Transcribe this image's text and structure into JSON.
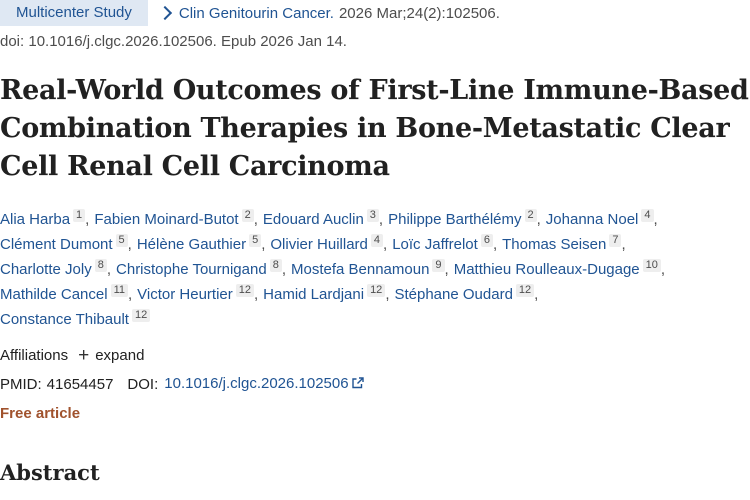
{
  "header": {
    "publication_type": "Multicenter Study",
    "journal_link": "Clin Genitourin Cancer.",
    "citation": "2026 Mar;24(2):102506.",
    "doi_line": "doi: 10.1016/j.clgc.2026.102506. Epub 2026 Jan 14."
  },
  "article": {
    "title": "Real-World Outcomes of First-Line Immune-Based Combination Therapies in Bone-Metastatic Clear Cell Renal Cell Carcinoma"
  },
  "authors": [
    [
      {
        "name": "Alia Harba",
        "aff": "1"
      },
      {
        "name": "Fabien Moinard-Butot",
        "aff": "2"
      },
      {
        "name": "Edouard Auclin",
        "aff": "3"
      },
      {
        "name": "Philippe Barthélémy",
        "aff": "2"
      },
      {
        "name": "Johanna Noel",
        "aff": "4"
      }
    ],
    [
      {
        "name": "Clément Dumont",
        "aff": "5"
      },
      {
        "name": "Hélène Gauthier",
        "aff": "5"
      },
      {
        "name": "Olivier Huillard",
        "aff": "4"
      },
      {
        "name": "Loïc Jaffrelot",
        "aff": "6"
      },
      {
        "name": "Thomas Seisen",
        "aff": "7"
      }
    ],
    [
      {
        "name": "Charlotte Joly",
        "aff": "8"
      },
      {
        "name": "Christophe Tournigand",
        "aff": "8"
      },
      {
        "name": "Mostefa Bennamoun",
        "aff": "9"
      },
      {
        "name": "Matthieu Roulleaux-Dugage",
        "aff": "10"
      }
    ],
    [
      {
        "name": "Mathilde Cancel",
        "aff": "11"
      },
      {
        "name": "Victor Heurtier",
        "aff": "12"
      },
      {
        "name": "Hamid Lardjani",
        "aff": "12"
      },
      {
        "name": "Stéphane Oudard",
        "aff": "12"
      }
    ],
    [
      {
        "name": "Constance Thibault",
        "aff": "12"
      }
    ]
  ],
  "affiliations": {
    "label": "Affiliations",
    "expand_label": "expand",
    "expand_icon": "plus-icon"
  },
  "identifiers": {
    "pmid_label": "PMID:",
    "pmid": "41654457",
    "doi_label": "DOI:",
    "doi": "10.1016/j.clgc.2026.102506",
    "doi_icon": "external-link-icon"
  },
  "free_article": "Free article",
  "abstract_heading": "Abstract",
  "colors": {
    "link": "#205493",
    "pub_type_bg": "#dfe8f3",
    "free_article": "#a0522d"
  }
}
